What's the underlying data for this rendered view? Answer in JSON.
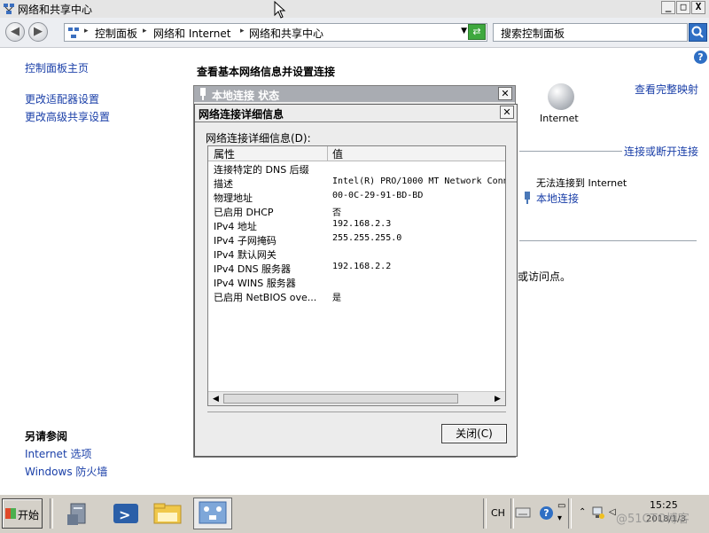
{
  "window": {
    "title": "网络和共享中心",
    "min": "_",
    "max": "□",
    "close": "X"
  },
  "address": {
    "crumbs": [
      "控制面板",
      "网络和 Internet",
      "网络和共享中心"
    ],
    "search_placeholder": "搜索控制面板"
  },
  "left": {
    "home": "控制面板主页",
    "links": [
      "更改适配器设置",
      "更改高级共享设置"
    ],
    "see_also_title": "另请参阅",
    "see_also": [
      "Internet 选项",
      "Windows 防火墙"
    ]
  },
  "main": {
    "heading": "查看基本网络信息并设置连接",
    "view_full_map": "查看完整映射",
    "internet_label": "Internet",
    "connect_disconnect": "连接或断开连接",
    "no_internet": "无法连接到 Internet",
    "local_conn": "本地连接",
    "access_point_tail": "或访问点。"
  },
  "status_dialog": {
    "title": "本地连接 状态"
  },
  "details_dialog": {
    "title": "网络连接详细信息",
    "label": "网络连接详细信息(D):",
    "col_property": "属性",
    "col_value": "值",
    "rows": [
      {
        "property": "连接特定的 DNS 后缀",
        "value": ""
      },
      {
        "property": "描述",
        "value": "Intel(R) PRO/1000 MT Network Conn"
      },
      {
        "property": "物理地址",
        "value": "00-0C-29-91-BD-BD"
      },
      {
        "property": "已启用 DHCP",
        "value": "否"
      },
      {
        "property": "IPv4 地址",
        "value": "192.168.2.3"
      },
      {
        "property": "IPv4 子网掩码",
        "value": "255.255.255.0"
      },
      {
        "property": "IPv4 默认网关",
        "value": ""
      },
      {
        "property": "IPv4 DNS 服务器",
        "value": "192.168.2.2"
      },
      {
        "property": "IPv4 WINS 服务器",
        "value": ""
      },
      {
        "property": "已启用 NetBIOS ove...",
        "value": "是"
      }
    ],
    "close_button": "关闭(C)"
  },
  "taskbar": {
    "start": "开始",
    "lang": "CH",
    "time": "15:25",
    "date": "2018/1/3",
    "watermark": "@51CTO博客"
  },
  "colors": {
    "link": "#1a3fa8",
    "dialog_bg": "#ececec",
    "taskbar": "#d4d0c8"
  }
}
